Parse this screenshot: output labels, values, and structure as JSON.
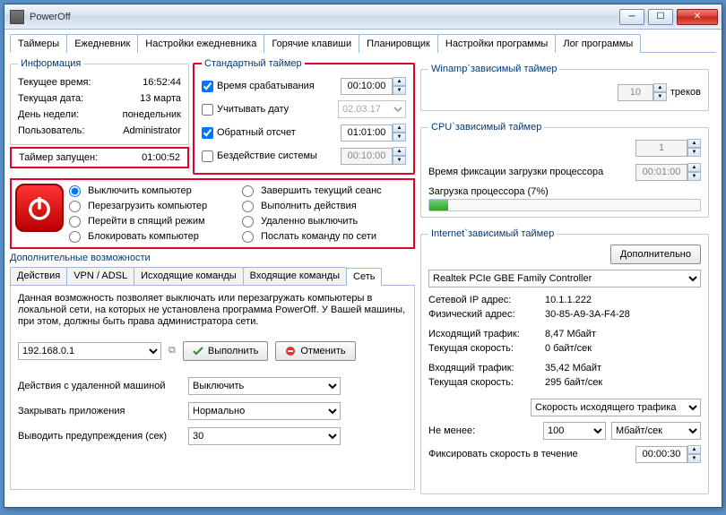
{
  "window": {
    "title": "PowerOff"
  },
  "mainTabs": [
    "Таймеры",
    "Ежедневник",
    "Настройки ежедневника",
    "Горячие клавиши",
    "Планировщик",
    "Настройки программы",
    "Лог программы"
  ],
  "info": {
    "legend": "Информация",
    "rows": [
      {
        "k": "Текущее время:",
        "v": "16:52:44"
      },
      {
        "k": "Текущая дата:",
        "v": "13 марта"
      },
      {
        "k": "День недели:",
        "v": "понедельник"
      },
      {
        "k": "Пользователь:",
        "v": "Administrator"
      }
    ]
  },
  "timerStarted": {
    "k": "Таймер запущен:",
    "v": "01:00:52"
  },
  "stdTimer": {
    "legend": "Стандартный таймер",
    "rows": [
      {
        "chk": true,
        "label": "Время срабатывания",
        "val": "00:10:00",
        "type": "spin"
      },
      {
        "chk": false,
        "label": "Учитывать дату",
        "val": "02.03.17",
        "type": "combo"
      },
      {
        "chk": true,
        "label": "Обратный отсчет",
        "val": "01:01:00",
        "type": "spin"
      },
      {
        "chk": false,
        "label": "Бездействие системы",
        "val": "00:10:00",
        "type": "spin"
      }
    ]
  },
  "actions": {
    "col1": [
      "Выключить компьютер",
      "Перезагрузить компьютер",
      "Перейти в спящий режим",
      "Блокировать компьютер"
    ],
    "col2": [
      "Завершить текущий сеанс",
      "Выполнить действия",
      "Удаленно выключить",
      "Послать команду по сети"
    ],
    "selected": 0
  },
  "extraLabel": "Дополнительные возможности",
  "subTabs": [
    "Действия",
    "VPN / ADSL",
    "Исходящие команды",
    "Входящие команды",
    "Сеть"
  ],
  "net": {
    "desc": "Данная возможность позволяет выключать или перезагружать компьютеры в локальной сети, на которых не установлена программа PowerOff. У Вашей машины, при этом, должны быть права администратора сети.",
    "ip": "192.168.0.1",
    "execute": "Выполнить",
    "cancel": "Отменить",
    "rows": [
      {
        "l": "Действия с удаленной машиной",
        "v": "Выключить"
      },
      {
        "l": "Закрывать приложения",
        "v": "Нормально"
      },
      {
        "l": "Выводить предупреждения (сек)",
        "v": "30"
      }
    ]
  },
  "winamp": {
    "legend": "Winamp`зависимый таймер",
    "tracks": "10",
    "tracksLabel": "треков"
  },
  "cpu": {
    "legend": "CPU`зависимый таймер",
    "threshold": "1",
    "fixLabel": "Время фиксации загрузки процессора",
    "fixVal": "00:01:00",
    "loadLabel": "Загрузка процессора (7%)",
    "loadPct": 7
  },
  "internet": {
    "legend": "Internet`зависимый таймер",
    "moreBtn": "Дополнительно",
    "adapter": "Realtek PCIe GBE Family Controller",
    "rows": [
      {
        "k": "Сетевой IP адрес:",
        "v": "10.1.1.222"
      },
      {
        "k": "Физический адрес:",
        "v": "30-85-A9-3A-F4-28"
      },
      {
        "k": "Исходящий трафик:",
        "v": "8,47 Мбайт"
      },
      {
        "k": "Текущая скорость:",
        "v": "0 байт/сек"
      },
      {
        "k": "Входящий трафик:",
        "v": "35,42 Мбайт"
      },
      {
        "k": "Текущая скорость:",
        "v": "295 байт/сек"
      }
    ],
    "speedCombo": "Скорость исходящего трафика",
    "notLess": "Не менее:",
    "notLessVal": "100",
    "unit": "Мбайт/сек",
    "fixLabel": "Фиксировать скорость в течение",
    "fixVal": "00:00:30"
  }
}
